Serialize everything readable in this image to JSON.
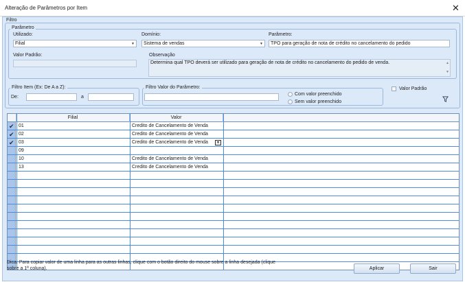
{
  "window": {
    "title": "Alteração de Parâmetros por Item",
    "close_label": "✕"
  },
  "filtro": {
    "title": "Filtro",
    "parametro_group": {
      "title": "Parâmetro",
      "utilizado_label": "Utilizado:",
      "utilizado_value": "Filial",
      "dominio_label": "Domínio:",
      "dominio_value": "Sistema de vendas",
      "parametro_label": "Parâmetro:",
      "parametro_value": "TPO para geração de nota de crédito no cancelamento do pedido",
      "valor_padrao_label": "Valor Padrão:",
      "valor_padrao_value": "",
      "observacao_label": "Observação",
      "observacao_value": "Determina qual TPO deverá ser utilizado para geração de nota de crédito no cancelamento do pedido de venda."
    },
    "filtro_item": {
      "title": "Filtro Item (Ex: De A a Z):",
      "de_label": "De:",
      "a_label": "a",
      "de_value": "",
      "a_value": ""
    },
    "filtro_valor": {
      "title": "Filtro Valor do Parâmetro:",
      "value": "",
      "option_com": "Com valor preenchido",
      "option_sem": "Sem valor preenchido"
    },
    "valor_padrao_checkbox": "Valor Padrão",
    "filter_icon": "filter-icon"
  },
  "grid": {
    "columns": [
      "Filial",
      "Valor"
    ],
    "rows": [
      {
        "checked": true,
        "filial": "01",
        "valor": "Credito de Cancelamento de Venda"
      },
      {
        "checked": true,
        "filial": "02",
        "valor": "Credito de Cancelamento de Venda"
      },
      {
        "checked": true,
        "filial": "03",
        "valor": "Credito de Cancelamento de Venda"
      },
      {
        "checked": false,
        "filial": "09",
        "valor": ""
      },
      {
        "checked": false,
        "filial": "10",
        "valor": "Credito de Cancelamento de Venda"
      },
      {
        "checked": false,
        "filial": "13",
        "valor": "Credito de Cancelamento de Venda"
      }
    ]
  },
  "footer": {
    "tip_line1": "Dica: Para copiar valor de uma linha para as outras linhas, clique com o botão direito do mouse sobre a linha desejada (clique",
    "tip_line2": "sobre a 1ª coluna).",
    "apply_label": "Aplicar",
    "exit_label": "Sair"
  },
  "colors": {
    "accent": "#4c8ce0",
    "panel": "#dbe9f9"
  }
}
